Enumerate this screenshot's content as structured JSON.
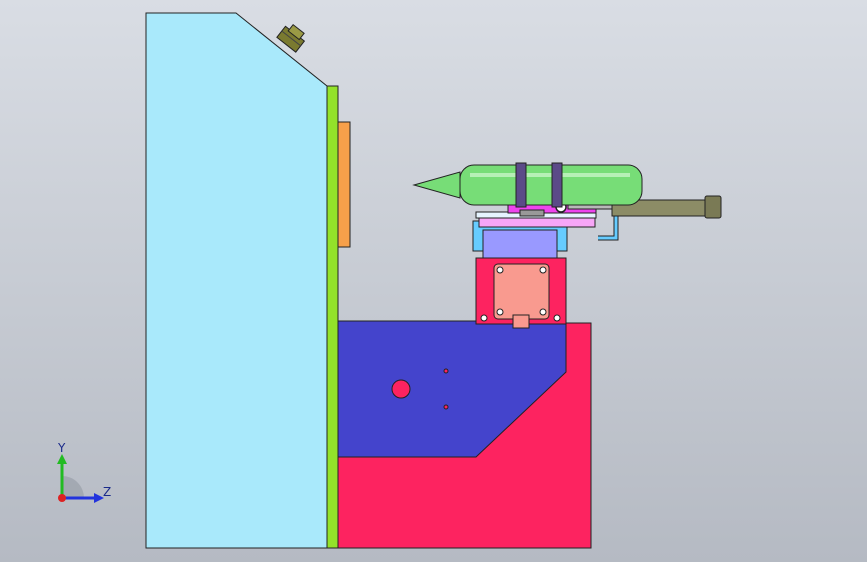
{
  "viewport": {
    "background_top": "#d9dde4",
    "background_bottom": "#b5bac3"
  },
  "model": {
    "colors": {
      "side_panel": "#a9e9fb",
      "green_rail": "#93e22a",
      "orange_pad": "#f7a04a",
      "blue_block": "#4444cc",
      "red_base": "#fd2360",
      "cylinder": "#77dd77",
      "magenta_bracket": "#ee44ee",
      "pink_plate": "#f7a6f7",
      "cyan_bracket": "#66ccff",
      "lavender_block": "#9999ff",
      "motor_face": "#f99a8f",
      "rod_gray": "#8c8c66",
      "knob": "#7a7a30"
    }
  },
  "triad": {
    "y_label": "Y",
    "z_label": "Z",
    "y_color": "#22bb22",
    "z_color": "#2233dd",
    "origin_color": "#dd2222"
  }
}
